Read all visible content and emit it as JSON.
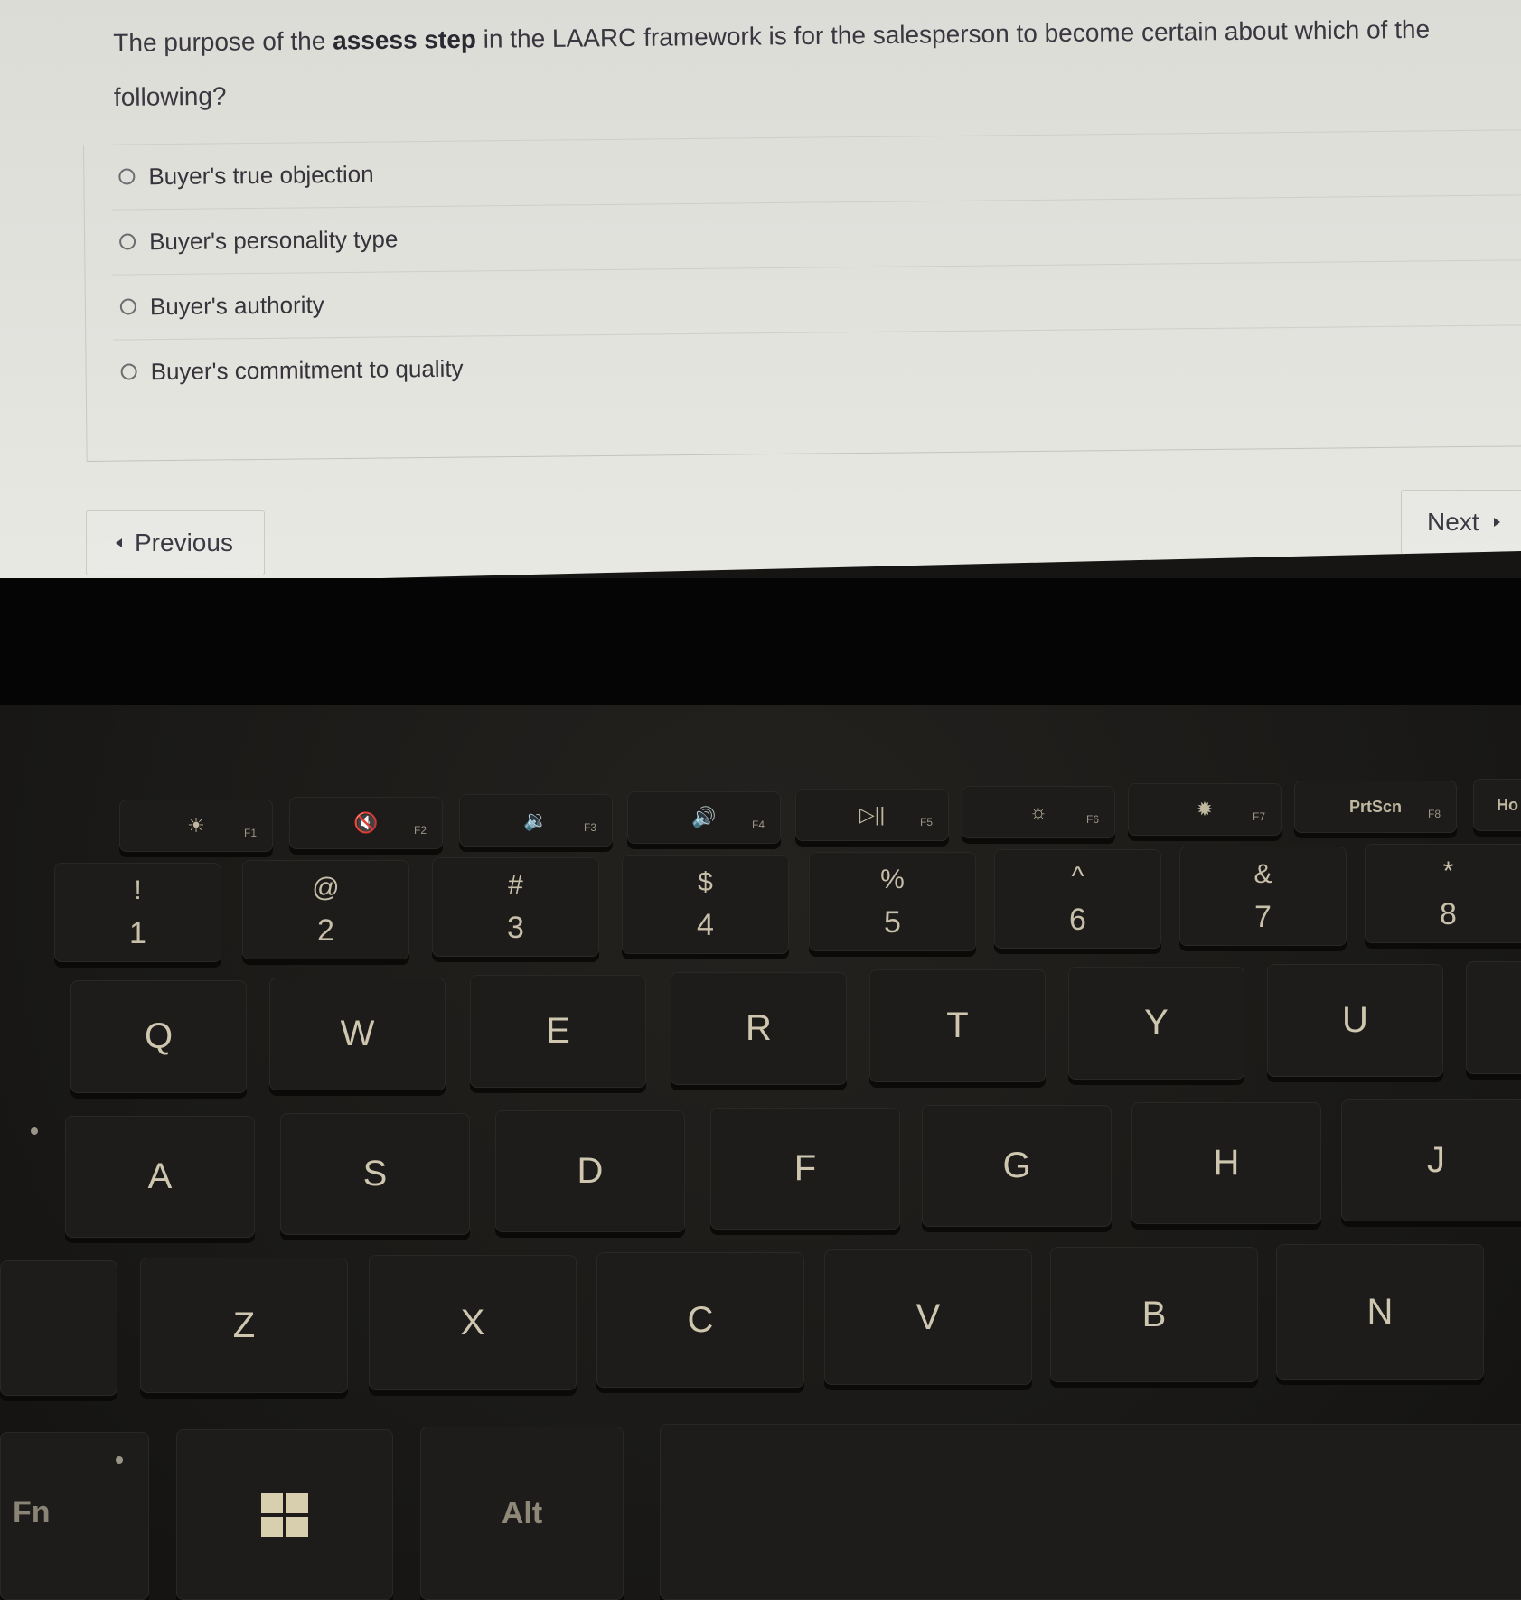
{
  "question": {
    "prefix": "The purpose of the ",
    "emphasis": "assess step",
    "suffix": " in the LAARC framework is for the salesperson to become certain about which of the following?"
  },
  "options": [
    {
      "label": "Buyer's true objection",
      "selected": false
    },
    {
      "label": "Buyer's personality type",
      "selected": false
    },
    {
      "label": "Buyer's authority",
      "selected": false
    },
    {
      "label": "Buyer's commitment to quality",
      "selected": false
    }
  ],
  "navigation": {
    "previous_label": "Previous",
    "next_label": "Next"
  },
  "keyboard": {
    "function_row": [
      {
        "icon": "brightness-down-icon",
        "symbol": "☀",
        "fn": "F1"
      },
      {
        "icon": "mute-icon",
        "symbol": "🔇",
        "fn": "F2"
      },
      {
        "icon": "volume-down-icon",
        "symbol": "🔉",
        "fn": "F3"
      },
      {
        "icon": "volume-up-icon",
        "symbol": "🔊",
        "fn": "F4"
      },
      {
        "icon": "play-pause-icon",
        "symbol": "▷||",
        "fn": "F5"
      },
      {
        "icon": "brightness-low-icon",
        "symbol": "☼",
        "fn": "F6"
      },
      {
        "icon": "brightness-high-icon",
        "symbol": "✹",
        "fn": "F7"
      },
      {
        "icon": "print-screen-label",
        "symbol": "PrtScn",
        "fn": "F8"
      },
      {
        "icon": "home-label",
        "symbol": "Ho",
        "fn": ""
      }
    ],
    "number_row": [
      {
        "top": "!",
        "bottom": "1"
      },
      {
        "top": "@",
        "bottom": "2"
      },
      {
        "top": "#",
        "bottom": "3"
      },
      {
        "top": "$",
        "bottom": "4"
      },
      {
        "top": "%",
        "bottom": "5"
      },
      {
        "top": "^",
        "bottom": "6"
      },
      {
        "top": "&",
        "bottom": "7"
      },
      {
        "top": "*",
        "bottom": "8"
      }
    ],
    "qwerty_row": [
      "Q",
      "W",
      "E",
      "R",
      "T",
      "Y",
      "U"
    ],
    "home_row": [
      "A",
      "S",
      "D",
      "F",
      "G",
      "H",
      "J"
    ],
    "bottom_letter_row": [
      "Z",
      "X",
      "C",
      "V",
      "B",
      "N"
    ],
    "modifiers": {
      "fn": "Fn",
      "alt": "Alt"
    }
  }
}
